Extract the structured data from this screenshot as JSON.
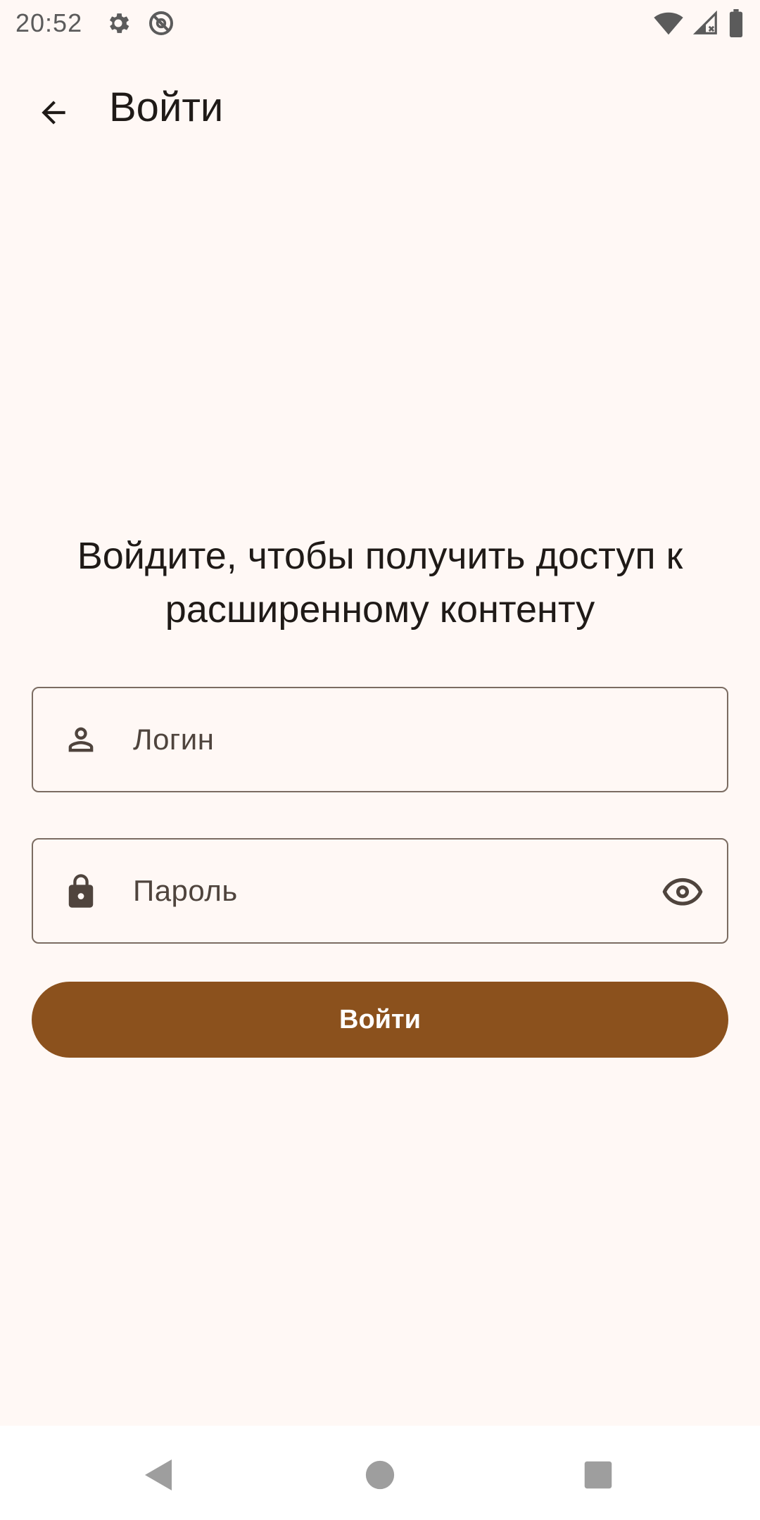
{
  "status_bar": {
    "time": "20:52",
    "icons": [
      "settings-icon",
      "no-sync-icon",
      "wifi-icon",
      "cellular-no-signal-icon",
      "battery-icon"
    ]
  },
  "top_bar": {
    "title": "Войти",
    "back_icon": "arrow-back-icon"
  },
  "headline": "Войдите, чтобы получить доступ к расширенному контенту",
  "form": {
    "login": {
      "placeholder": "Логин",
      "icon": "person-icon"
    },
    "password": {
      "placeholder": "Пароль",
      "icon": "lock-icon",
      "toggle_icon": "eye-icon"
    },
    "submit_label": "Войти"
  },
  "nav_bar": {
    "icons": [
      "nav-back-icon",
      "nav-home-icon",
      "nav-recents-icon"
    ]
  },
  "colors": {
    "background": "#FFF8F5",
    "accent": "#8B511D",
    "outline": "#7B6C62",
    "text": "#1F1A17"
  }
}
